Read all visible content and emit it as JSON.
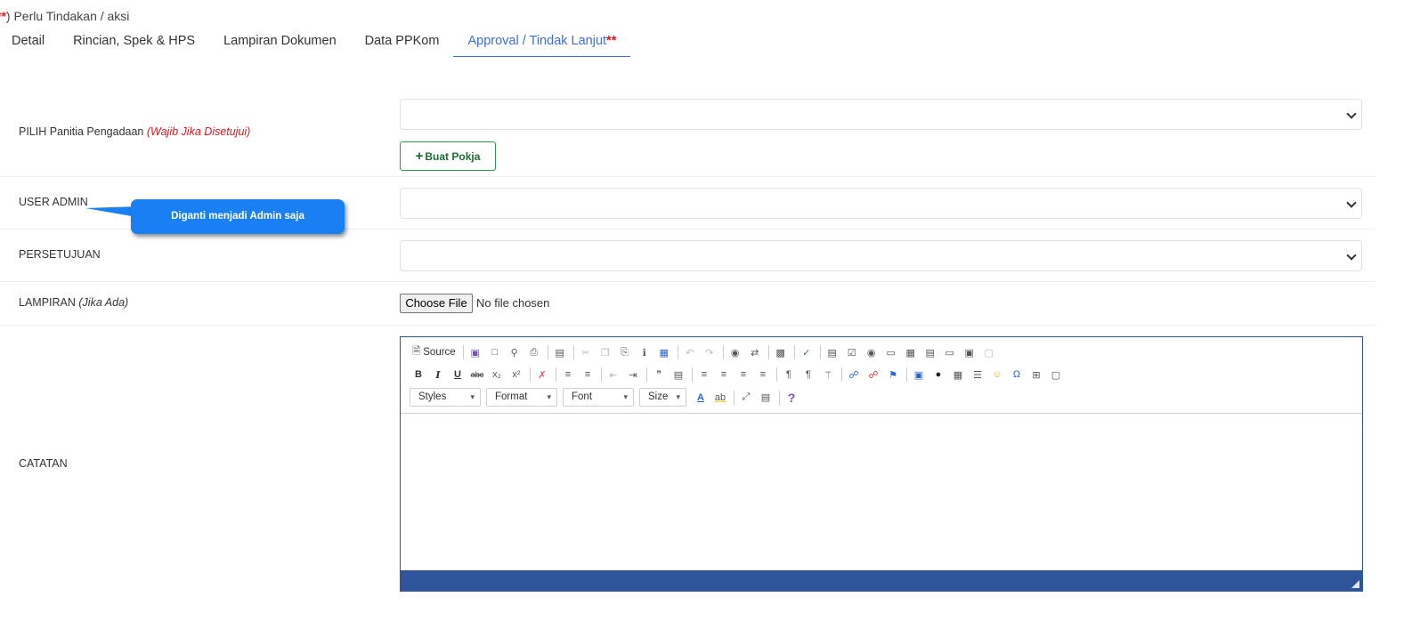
{
  "note": {
    "prefix": "**",
    "text": ") Perlu Tindakan / aksi"
  },
  "tabs": [
    {
      "label": "Detail"
    },
    {
      "label": "Rincian, Spek & HPS"
    },
    {
      "label": "Lampiran Dokumen"
    },
    {
      "label": "Data PPKom"
    },
    {
      "label": "Approval / Tindak Lanjut",
      "marker": "**",
      "active": true
    }
  ],
  "form": {
    "panitia": {
      "label": "PILIH Panitia Pengadaan",
      "hint": "(Wajib Jika Disetujui)",
      "value": ""
    },
    "buat_pokja": {
      "icon": "plus-icon",
      "label": "Buat Pokja"
    },
    "user_admin": {
      "label": "USER ADMIN",
      "value": ""
    },
    "persetujuan": {
      "label": "PERSETUJUAN",
      "value": ""
    },
    "lampiran": {
      "label": "LAMPIRAN",
      "hint": "(Jika Ada)",
      "button": "Choose File",
      "status": "No file chosen"
    },
    "catatan": {
      "label": "CATATAN"
    }
  },
  "callout": {
    "text": "Diganti  menjadi Admin saja"
  },
  "editor": {
    "source_label": "Source",
    "combos": [
      "Styles",
      "Format",
      "Font",
      "Size"
    ],
    "colors": {
      "border": "#2d5699",
      "status_bar": "#2e5599"
    }
  },
  "colors": {
    "accent": "#3b6fd8",
    "required": "#e0161c",
    "success": "#2b9a4a",
    "callout": "#1a7ff2"
  }
}
